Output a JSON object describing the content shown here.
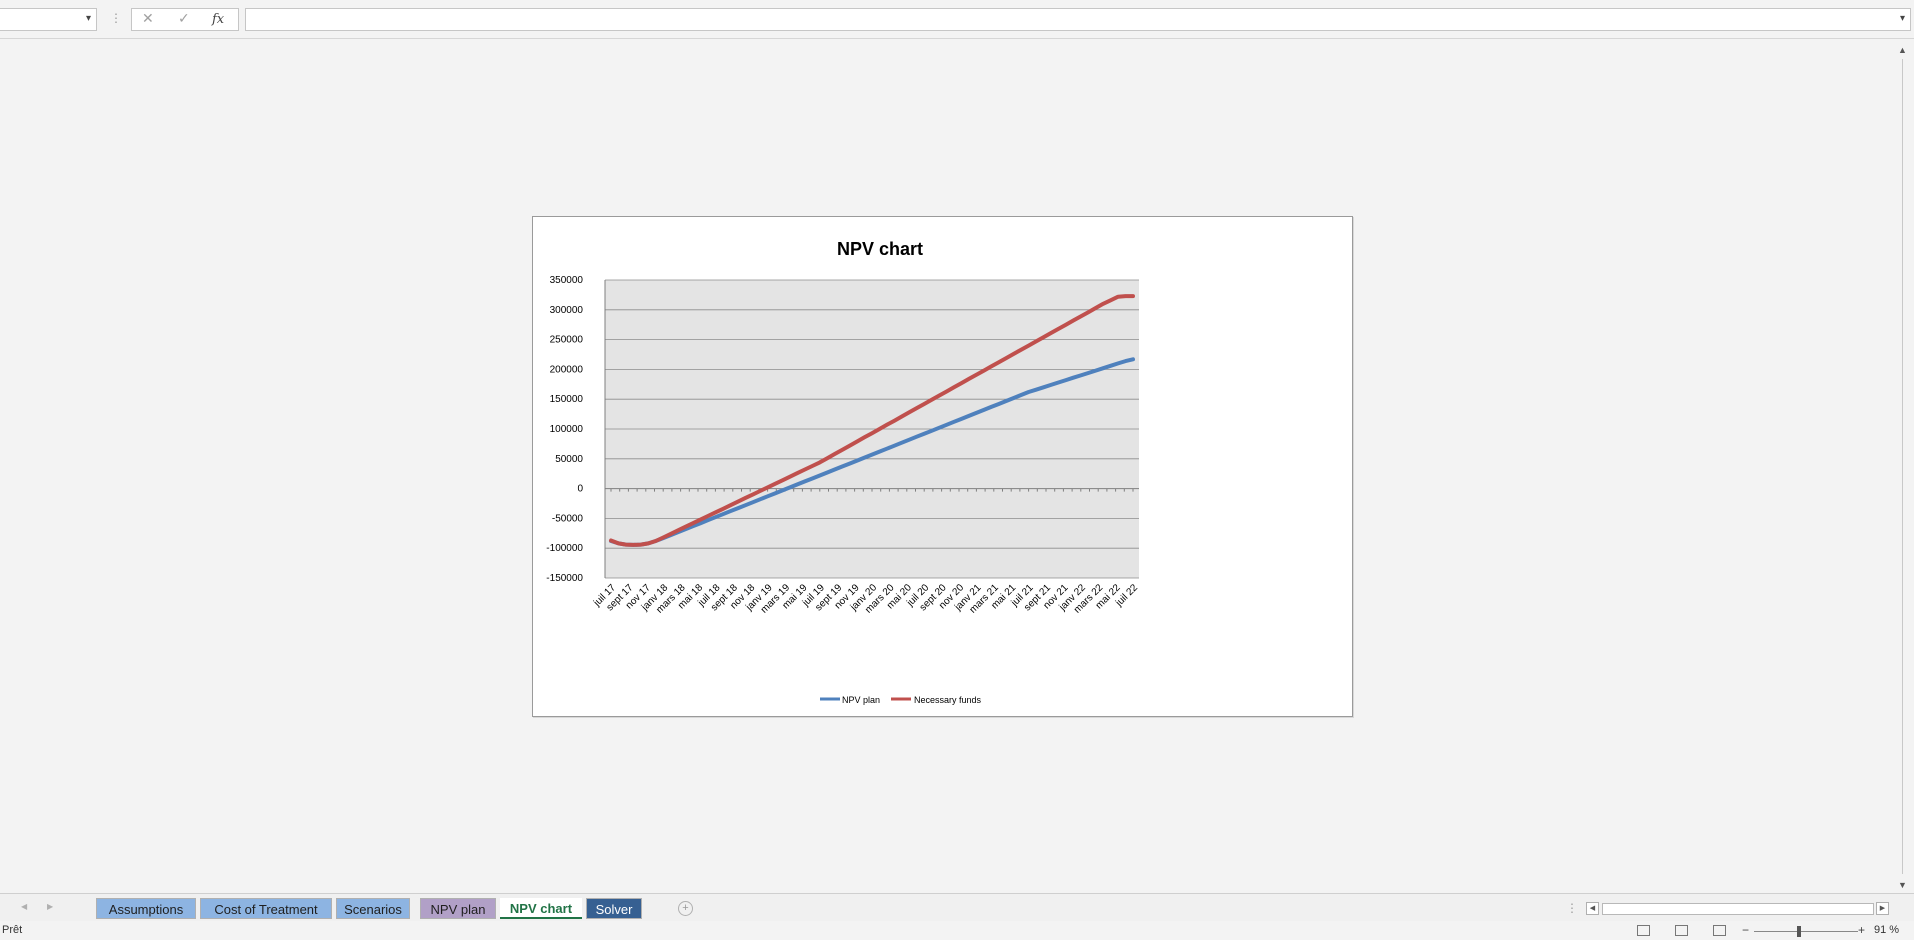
{
  "formula_bar": {
    "cancel_icon": "✕",
    "confirm_icon": "✓",
    "fx_label": "fx",
    "formula_value": ""
  },
  "sheets": [
    {
      "label": "Assumptions",
      "color": "#8db4e2",
      "active": false
    },
    {
      "label": "Cost of Treatment",
      "color": "#8db4e2",
      "active": false
    },
    {
      "label": "Scenarios",
      "color": "#8db4e2",
      "active": false
    },
    {
      "label": "NPV plan",
      "color": "#b1a0c7",
      "active": false
    },
    {
      "label": "NPV chart",
      "color": "#ffffff",
      "active": true
    },
    {
      "label": "Solver",
      "color": "#366092",
      "active": false
    }
  ],
  "status": {
    "ready_text": "Prêt",
    "zoom_level": "91 %",
    "zoom_fraction": 0.41
  },
  "chart_data": {
    "type": "line",
    "title": "NPV chart",
    "xlabel": "",
    "ylabel": "",
    "ylim": [
      -150000,
      350000
    ],
    "yticks": [
      "350000",
      "300000",
      "250000",
      "200000",
      "150000",
      "100000",
      "50000",
      "0",
      "-50000",
      "-100000",
      "-150000"
    ],
    "x_labels": [
      "juil 17",
      "sept 17",
      "nov 17",
      "janv 18",
      "mars 18",
      "mai 18",
      "juil 18",
      "sept 18",
      "nov 18",
      "janv 19",
      "mars 19",
      "mai 19",
      "juil 19",
      "sept 19",
      "nov 19",
      "janv 20",
      "mars 20",
      "mai 20",
      "juil 20",
      "sept 20",
      "nov 20",
      "janv 21",
      "mars 21",
      "mai 21",
      "juil 21",
      "sept 21",
      "nov 21",
      "janv 22",
      "mars 22",
      "mai 22",
      "juil 22"
    ],
    "months": 61,
    "grid": true,
    "legend_position": "bottom",
    "series": [
      {
        "name": "NPV plan",
        "color": "#4f81bd",
        "values": [
          -88000,
          -92000,
          -94000,
          -94500,
          -94000,
          -92000,
          -88000,
          -83000,
          -78000,
          -73000,
          -68000,
          -63000,
          -58000,
          -53000,
          -48000,
          -43000,
          -38000,
          -33000,
          -28000,
          -23000,
          -18000,
          -13000,
          -8000,
          -3000,
          2000,
          7000,
          12000,
          17000,
          22000,
          27000,
          32000,
          37000,
          42000,
          47000,
          52000,
          57000,
          62000,
          67000,
          72000,
          77000,
          82000,
          87000,
          92000,
          97000,
          102000,
          107000,
          112000,
          117000,
          122000,
          127000,
          132000,
          137000,
          142000,
          147000,
          152000,
          157000,
          162000,
          166000,
          170000,
          174000,
          178000,
          182000,
          186000,
          190000,
          194000,
          198000,
          202000,
          206000,
          210000,
          214000,
          217000
        ]
      },
      {
        "name": "Necessary funds",
        "color": "#c0504d",
        "values": [
          -87000,
          -92000,
          -94000,
          -94500,
          -94000,
          -92000,
          -88000,
          -82000,
          -76000,
          -70000,
          -64000,
          -58000,
          -52000,
          -46000,
          -40000,
          -34000,
          -28000,
          -22000,
          -16000,
          -10000,
          -4000,
          2000,
          8000,
          14000,
          20000,
          26000,
          32000,
          38000,
          44000,
          51000,
          58000,
          65000,
          72000,
          79000,
          86000,
          93000,
          100000,
          107000,
          114000,
          121000,
          128000,
          135000,
          142000,
          149000,
          156000,
          163000,
          170000,
          177000,
          184000,
          191000,
          198000,
          205000,
          212000,
          219000,
          226000,
          233000,
          240000,
          247000,
          254000,
          261000,
          268000,
          275000,
          282000,
          289000,
          296000,
          303000,
          310000,
          316000,
          322000,
          323000,
          323000
        ]
      }
    ]
  }
}
